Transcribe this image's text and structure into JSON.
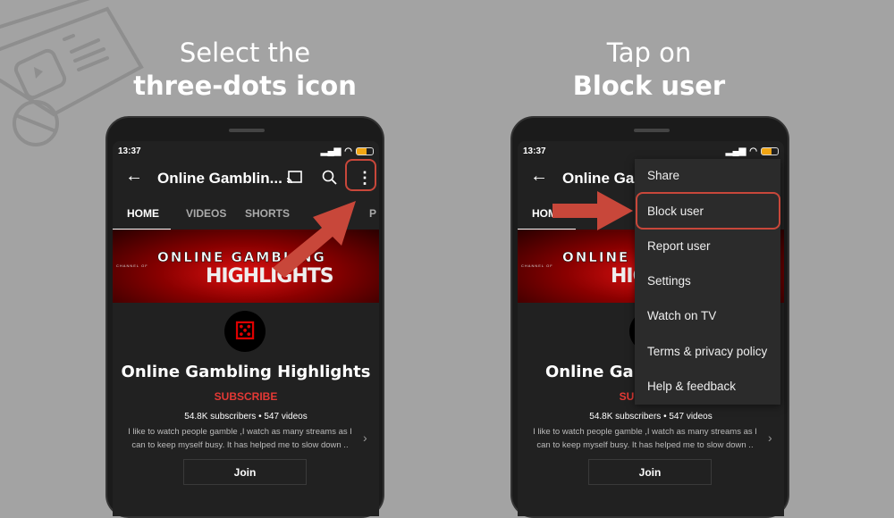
{
  "instructions": [
    {
      "line1": "Select the",
      "line2": "three-dots icon"
    },
    {
      "line1": "Tap on",
      "line2": "Block user"
    }
  ],
  "status": {
    "time": "13:37"
  },
  "toolbar": {
    "back": "←",
    "title": "Online Gamblin...",
    "title_short": "Online Gam",
    "more": "⋮"
  },
  "tabs": [
    "HOME",
    "VIDEOS",
    "SHORTS",
    "P"
  ],
  "tab_short": "HOM",
  "banner": {
    "top": "ONLINE GAMBLING",
    "bottom": "HIGHLIGHTS",
    "tag": "CHANNEL OF"
  },
  "channel": {
    "name": "Online Gambling Highlights",
    "name_short": "Online Gaml",
    "subscribe": "SUBSCRIBE",
    "subscribe_short": "SU",
    "stats": "54.8K subscribers • 547 videos",
    "description": "I like to watch people gamble ,I watch as many streams as I can to keep myself busy. It has helped me to slow down ..",
    "join": "Join"
  },
  "menu": {
    "items": [
      "Share",
      "Block user",
      "Report user",
      "Settings",
      "Watch on TV",
      "Terms & privacy policy",
      "Help & feedback"
    ],
    "highlighted": "Block user"
  },
  "colors": {
    "accent": "#c8473a",
    "subscribe": "#e53935",
    "background": "#a3a3a3"
  }
}
